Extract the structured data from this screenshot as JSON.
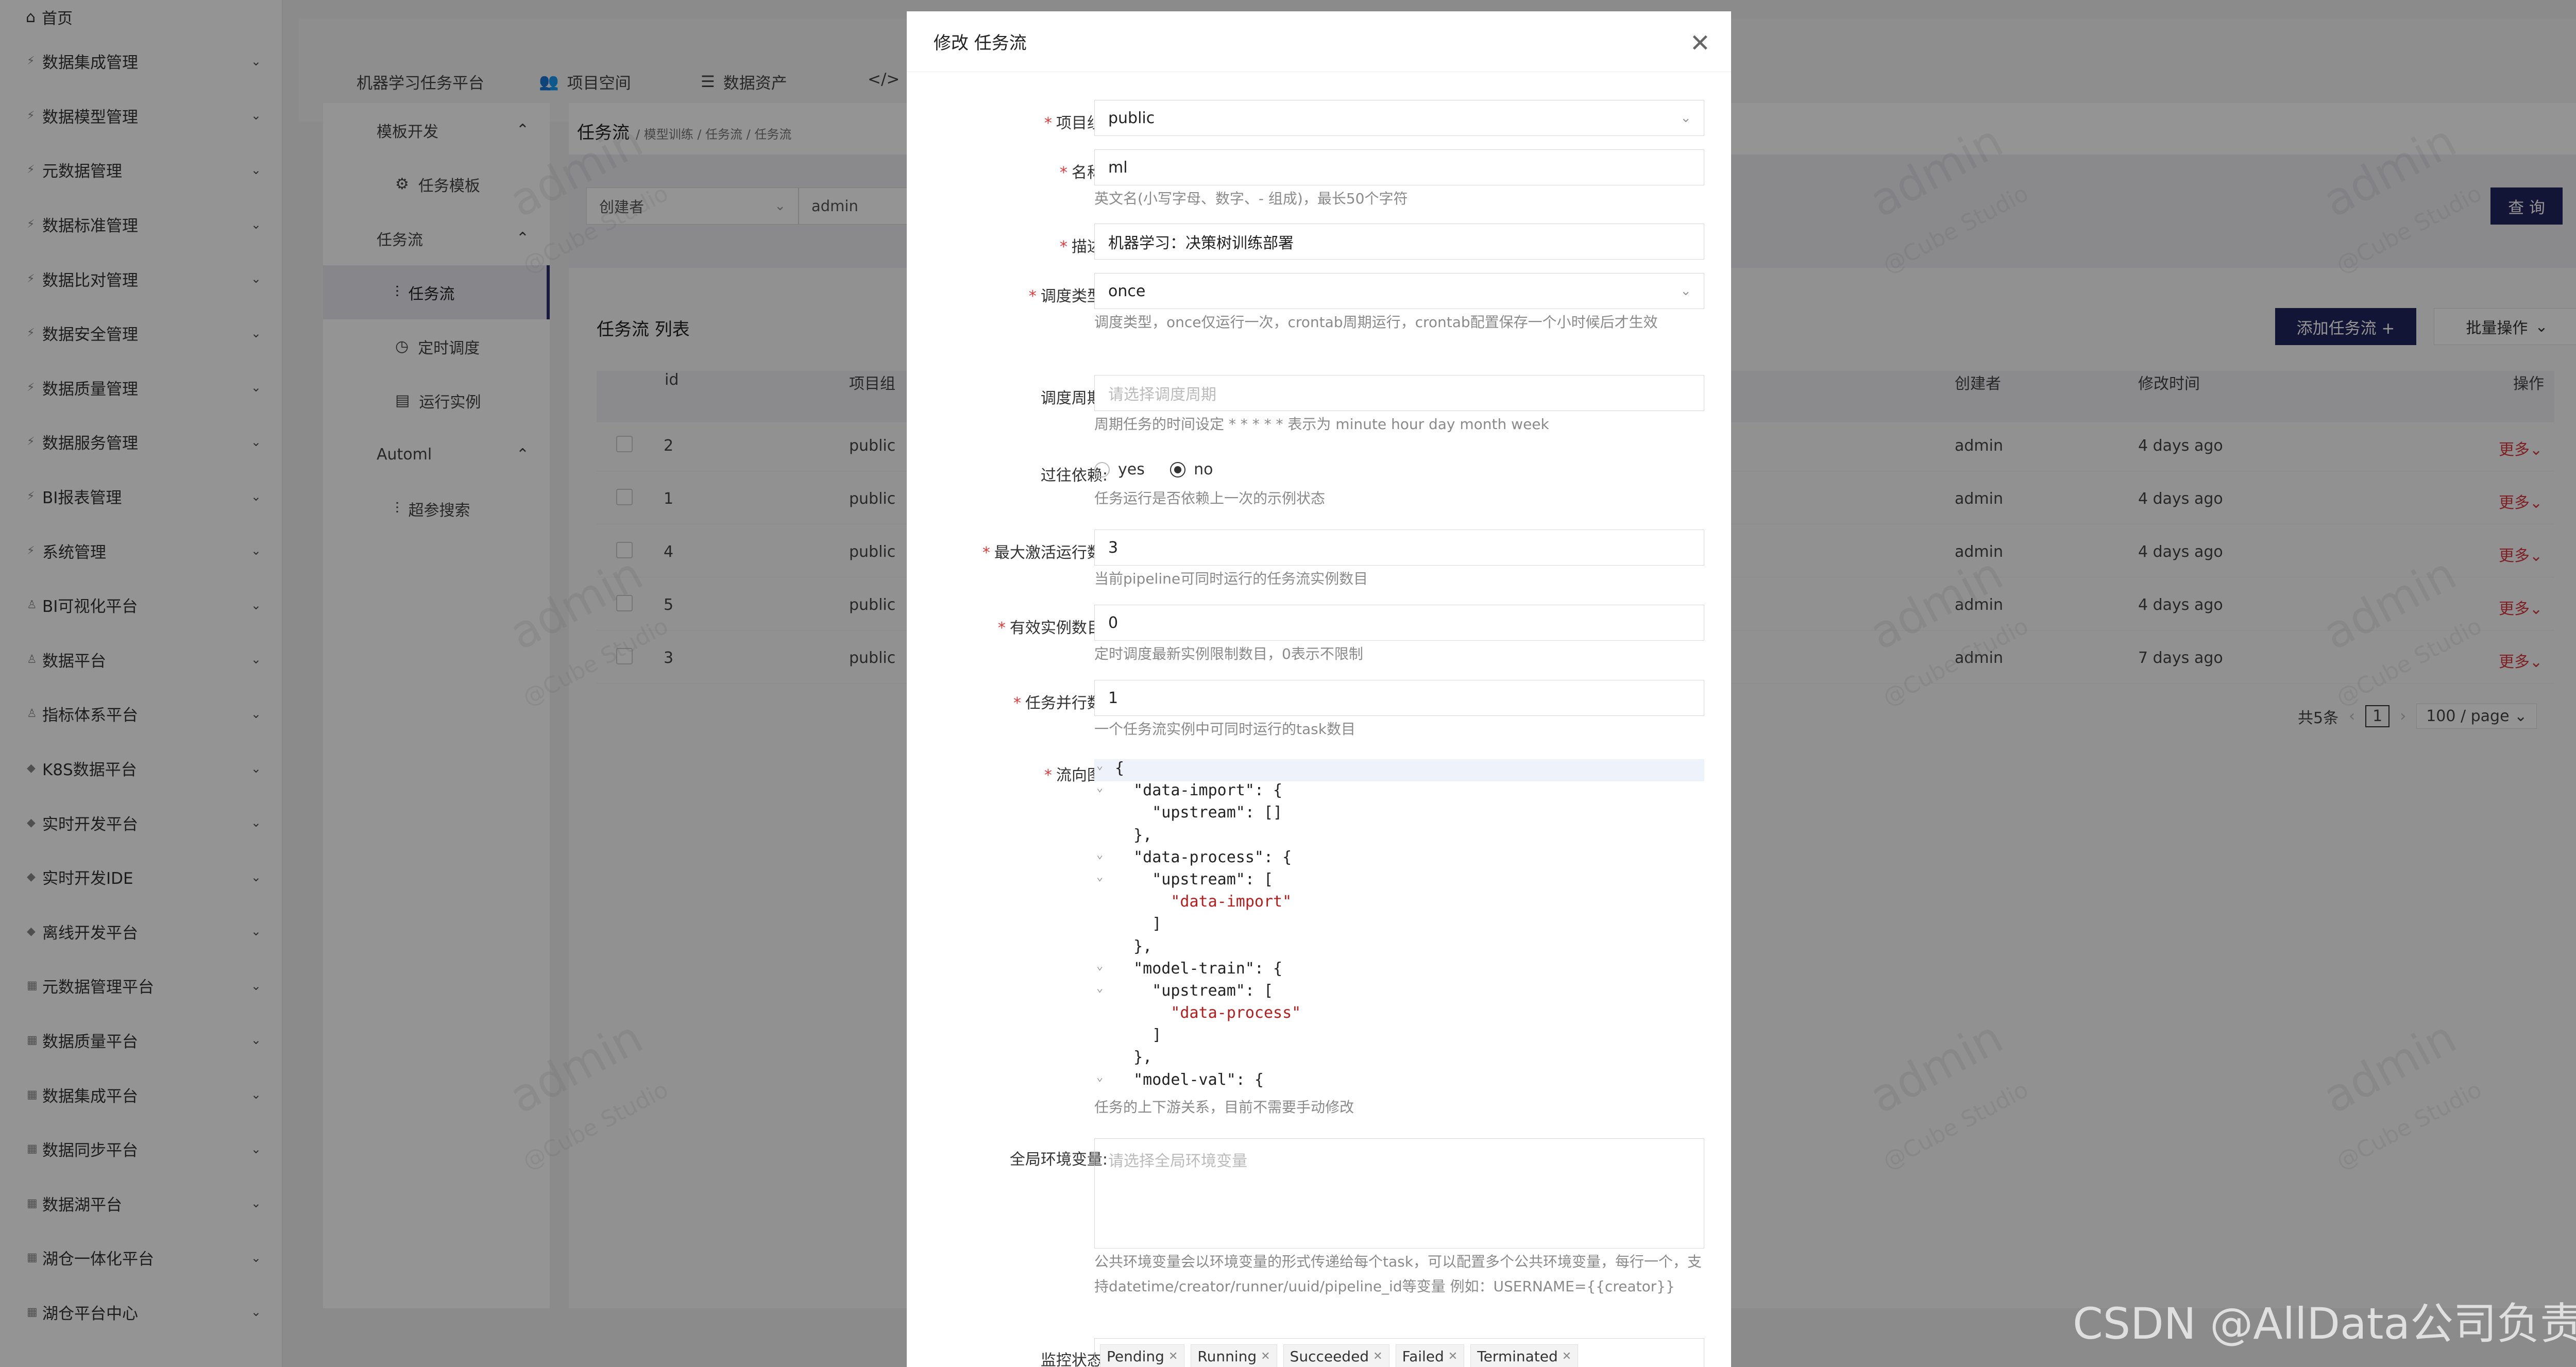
{
  "sidebar": {
    "home": "首页",
    "items": [
      {
        "label": "数据集成管理",
        "icon": "bolt-icon"
      },
      {
        "label": "数据模型管理",
        "icon": "bolt-icon"
      },
      {
        "label": "元数据管理",
        "icon": "bolt-icon"
      },
      {
        "label": "数据标准管理",
        "icon": "bolt-icon"
      },
      {
        "label": "数据比对管理",
        "icon": "bolt-icon"
      },
      {
        "label": "数据安全管理",
        "icon": "bolt-icon"
      },
      {
        "label": "数据质量管理",
        "icon": "bolt-icon"
      },
      {
        "label": "数据服务管理",
        "icon": "bolt-icon"
      },
      {
        "label": "BI报表管理",
        "icon": "bolt-icon"
      },
      {
        "label": "系统管理",
        "icon": "bolt-icon"
      },
      {
        "label": "BI可视化平台",
        "icon": "person-icon"
      },
      {
        "label": "数据平台",
        "icon": "person-icon"
      },
      {
        "label": "指标体系平台",
        "icon": "person-icon"
      },
      {
        "label": "K8S数据平台",
        "icon": "diamond-icon"
      },
      {
        "label": "实时开发平台",
        "icon": "diamond-icon"
      },
      {
        "label": "实时开发IDE",
        "icon": "diamond-icon"
      },
      {
        "label": "离线开发平台",
        "icon": "diamond-icon"
      },
      {
        "label": "元数据管理平台",
        "icon": "grid-icon"
      },
      {
        "label": "数据质量平台",
        "icon": "grid-icon"
      },
      {
        "label": "数据集成平台",
        "icon": "grid-icon"
      },
      {
        "label": "数据同步平台",
        "icon": "grid-icon"
      },
      {
        "label": "数据湖平台",
        "icon": "grid-icon"
      },
      {
        "label": "湖仓一体化平台",
        "icon": "grid-icon"
      },
      {
        "label": "湖仓平台中心",
        "icon": "grid-icon"
      }
    ]
  },
  "topnav": {
    "tabs": [
      "机器学习任务平台",
      "项目空间",
      "数据资产"
    ]
  },
  "subnav": {
    "group1": "模板开发",
    "group1_sub": "任务模板",
    "group2": "任务流",
    "group2_sub1": "任务流",
    "group2_sub2": "定时调度",
    "group2_sub3": "运行实例",
    "group3": "Automl",
    "group3_sub": "超参搜索"
  },
  "page": {
    "title": "任务流",
    "breadcrumb": "/ 模型训练 / 任务流 / 任务流",
    "filter_field": "创建者",
    "filter_value": "admin",
    "query_button": "查 询",
    "list_title": "任务流 列表",
    "add_button": "添加任务流 +",
    "batch_button": "批量操作",
    "columns": [
      "id",
      "项目组",
      "创建者",
      "修改时间",
      "操作"
    ],
    "rows": [
      {
        "id": "2",
        "group": "public",
        "creator": "admin",
        "modified": "4 days ago",
        "action": "更多"
      },
      {
        "id": "1",
        "group": "public",
        "creator": "admin",
        "modified": "4 days ago",
        "action": "更多"
      },
      {
        "id": "4",
        "group": "public",
        "creator": "admin",
        "modified": "4 days ago",
        "action": "更多"
      },
      {
        "id": "5",
        "group": "public",
        "creator": "admin",
        "modified": "4 days ago",
        "action": "更多"
      },
      {
        "id": "3",
        "group": "public",
        "creator": "admin",
        "modified": "7 days ago",
        "action": "更多"
      }
    ],
    "total": "共5条",
    "page_num": "1",
    "page_size": "100 / page",
    "watermark": "admin",
    "watermark_sub": "@Cube Studio"
  },
  "modal": {
    "title": "修改 任务流",
    "fields": {
      "project_group": {
        "label": "项目组:",
        "value": "public"
      },
      "name": {
        "label": "名称:",
        "value": "ml",
        "help": "英文名(小写字母、数字、- 组成)，最长50个字符"
      },
      "desc": {
        "label": "描述:",
        "value": "机器学习：决策树训练部署"
      },
      "schedule_type": {
        "label": "调度类型:",
        "value": "once",
        "help": "调度类型，once仅运行一次，crontab周期运行，crontab配置保存一个小时候后才生效"
      },
      "schedule_cycle": {
        "label": "调度周期:",
        "placeholder": "请选择调度周期",
        "help": "周期任务的时间设定 * * * * * 表示为 minute hour day month week"
      },
      "depends_on_past": {
        "label": "过往依赖:",
        "opt_yes": "yes",
        "opt_no": "no",
        "help": "任务运行是否依赖上一次的示例状态"
      },
      "max_active_runs": {
        "label": "最大激活运行数:",
        "value": "3",
        "help": "当前pipeline可同时运行的任务流实例数目"
      },
      "expired_limit": {
        "label": "有效实例数目:",
        "value": "0",
        "help": "定时调度最新实例限制数目，0表示不限制"
      },
      "parallelism": {
        "label": "任务并行数:",
        "value": "1",
        "help": "一个任务流实例中可同时运行的task数目"
      },
      "dag_json": {
        "label": "流向图:",
        "help": "任务的上下游关系，目前不需要手动修改"
      },
      "global_env": {
        "label": "全局环境变量:",
        "placeholder": "请选择全局环境变量",
        "help": "公共环境变量会以环境变量的形式传递给每个task，可以配置多个公共环境变量，每行一个，支持datetime/creator/runner/uuid/pipeline_id等变量 例如：USERNAME={{creator}}"
      },
      "alert_status": {
        "label": "监控状态:",
        "tags": [
          "Pending",
          "Running",
          "Succeeded",
          "Failed",
          "Terminated"
        ]
      }
    },
    "code_lines": [
      "{",
      "  \"data-import\": {",
      "    \"upstream\": []",
      "  },",
      "  \"data-process\": {",
      "    \"upstream\": [",
      "      \"data-import\"",
      "    ]",
      "  },",
      "  \"model-train\": {",
      "    \"upstream\": [",
      "      \"data-process\"",
      "    ]",
      "  },",
      "  \"model-val\": {"
    ]
  },
  "footer_watermark": "CSDN @AllData公司负责人"
}
